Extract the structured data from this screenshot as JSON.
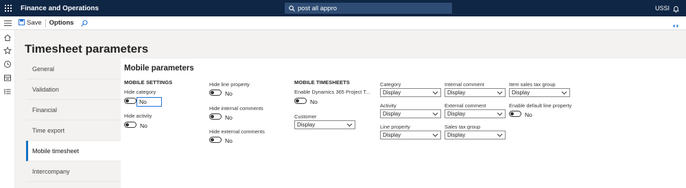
{
  "topbar": {
    "app_title": "Finance and Operations",
    "search_text": "post all appro",
    "company": "USSI"
  },
  "actionbar": {
    "save_label": "Save",
    "options_label": "Options"
  },
  "page": {
    "title": "Timesheet parameters"
  },
  "tabs": [
    {
      "label": "General"
    },
    {
      "label": "Validation"
    },
    {
      "label": "Financial"
    },
    {
      "label": "Time export"
    },
    {
      "label": "Mobile timesheet"
    },
    {
      "label": "Intercompany"
    }
  ],
  "panel": {
    "title": "Mobile parameters",
    "mobile_settings": {
      "heading": "MOBILE SETTINGS",
      "hide_category_label": "Hide category",
      "hide_category_value": "No",
      "hide_activity_label": "Hide activity",
      "hide_activity_value": "No"
    },
    "col2": {
      "hide_line_property_label": "Hide line property",
      "hide_line_property_value": "No",
      "hide_internal_comments_label": "Hide internal comments",
      "hide_internal_comments_value": "No",
      "hide_external_comments_label": "Hide external comments",
      "hide_external_comments_value": "No"
    },
    "mobile_timesheets": {
      "heading": "MOBILE TIMESHEETS",
      "enable_label": "Enable Dynamics 365 Project T...",
      "enable_value": "No",
      "customer_label": "Customer",
      "customer_value": "Display"
    },
    "col4": {
      "category_label": "Category",
      "category_value": "Display",
      "activity_label": "Activity",
      "activity_value": "Display",
      "line_property_label": "Line property",
      "line_property_value": "Display"
    },
    "col5": {
      "internal_comment_label": "Internal comment",
      "internal_comment_value": "Display",
      "external_comment_label": "External comment",
      "external_comment_value": "Display",
      "sales_tax_group_label": "Sales tax group",
      "sales_tax_group_value": "Display"
    },
    "col6": {
      "item_sales_tax_group_label": "Item sales tax group",
      "item_sales_tax_group_value": "Display",
      "enable_default_line_property_label": "Enable default line property",
      "enable_default_line_property_value": "No"
    }
  },
  "colors": {
    "topbar_bg": "#0f2645",
    "search_bg": "#2f4d74",
    "accent": "#106ebe"
  },
  "icons": [
    "waffle-icon",
    "search-icon",
    "bell-icon",
    "hamburger-icon",
    "save-icon",
    "diamond-icon",
    "home-icon",
    "star-icon",
    "clock-icon",
    "workspace-icon",
    "list-icon",
    "chevron-down-icon"
  ]
}
